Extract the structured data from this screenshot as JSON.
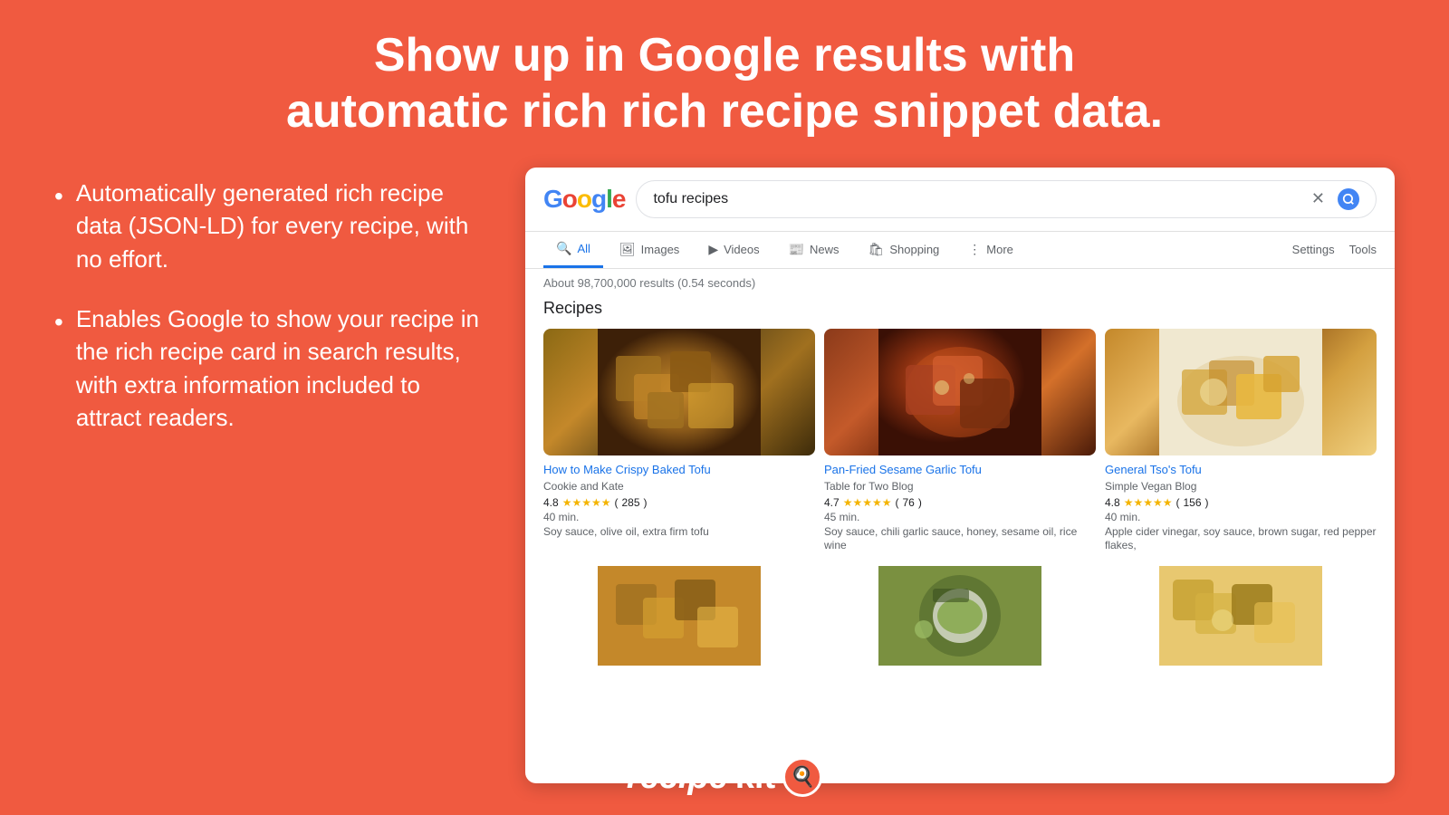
{
  "header": {
    "title_line1": "Show up in Google results with",
    "title_line2": "automatic rich rich recipe snippet data."
  },
  "bullets": [
    {
      "text": "Automatically generated rich recipe data (JSON-LD) for every recipe, with no effort."
    },
    {
      "text": "Enables Google to show your recipe in the rich recipe card in search results, with extra information included to attract readers."
    }
  ],
  "google_panel": {
    "logo": "oogle",
    "logo_partial": "gle",
    "search_query": "tofu recipes",
    "results_count": "About 98,700,000 results (0.54 seconds)",
    "recipes_label": "Recipes",
    "nav_tabs": [
      {
        "label": "All",
        "icon": "🔍",
        "active": true
      },
      {
        "label": "Images",
        "icon": "🖼"
      },
      {
        "label": "Videos",
        "icon": "▶"
      },
      {
        "label": "News",
        "icon": "📰"
      },
      {
        "label": "Shopping",
        "icon": "🛍"
      },
      {
        "label": "More",
        "icon": ""
      }
    ],
    "nav_right": [
      "Settings",
      "Tools"
    ],
    "recipes": [
      {
        "title": "How to Make Crispy Baked Tofu",
        "source": "Cookie and Kate",
        "rating": "4.8",
        "review_count": "285",
        "time": "40 min.",
        "ingredients": "Soy sauce, olive oil, extra firm tofu",
        "thumb_class": "thumb-1"
      },
      {
        "title": "Pan-Fried Sesame Garlic Tofu",
        "source": "Table for Two Blog",
        "rating": "4.7",
        "review_count": "76",
        "time": "45 min.",
        "ingredients": "Soy sauce, chili garlic sauce, honey, sesame oil, rice wine",
        "thumb_class": "thumb-2"
      },
      {
        "title": "General Tso's Tofu",
        "source": "Simple Vegan Blog",
        "rating": "4.8",
        "review_count": "156",
        "time": "40 min.",
        "ingredients": "Apple cider vinegar, soy sauce, brown sugar, red pepper flakes,",
        "thumb_class": "thumb-3"
      }
    ],
    "bottom_thumbs": [
      "thumb-4",
      "thumb-5",
      "thumb-6"
    ]
  },
  "brand": {
    "name_recipe": "recipe",
    "name_kit": "kit"
  }
}
